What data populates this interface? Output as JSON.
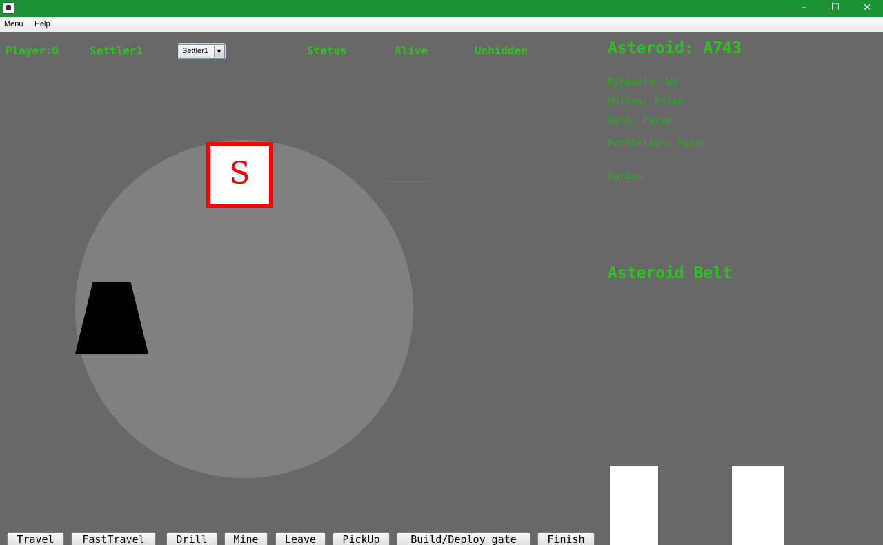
{
  "window": {
    "minimize": "–",
    "maximize": "☐",
    "close": "✕"
  },
  "menubar": {
    "items": [
      "Menu",
      "Help"
    ]
  },
  "hud": {
    "player": "Player:0",
    "settler_name": "Settler1",
    "status_label": "Status",
    "alive": "Alive",
    "visibility": "Unhidden",
    "settler_select": {
      "selected": "Settler1",
      "arrow": "▼"
    }
  },
  "board": {
    "settler_letter": "S"
  },
  "asteroid_info": {
    "title": "Asteroid: A743",
    "mineable": "Mineable: No",
    "hollow": "Hollow: False",
    "gate": "Gate: False",
    "perihelion": "Perihelion: False",
    "material": "Carbon"
  },
  "belt": {
    "title": "Asteroid Belt"
  },
  "actions": [
    "Travel",
    "FastTravel",
    "Drill",
    "Mine",
    "Leave",
    "PickUp",
    "Build/Deploy gate",
    "Finish"
  ],
  "colors": {
    "titlebar": "#1b9236",
    "background": "#686868",
    "asteroid": "#808080",
    "hud_text": "#2ec21e",
    "settler_border": "#ff0000"
  }
}
